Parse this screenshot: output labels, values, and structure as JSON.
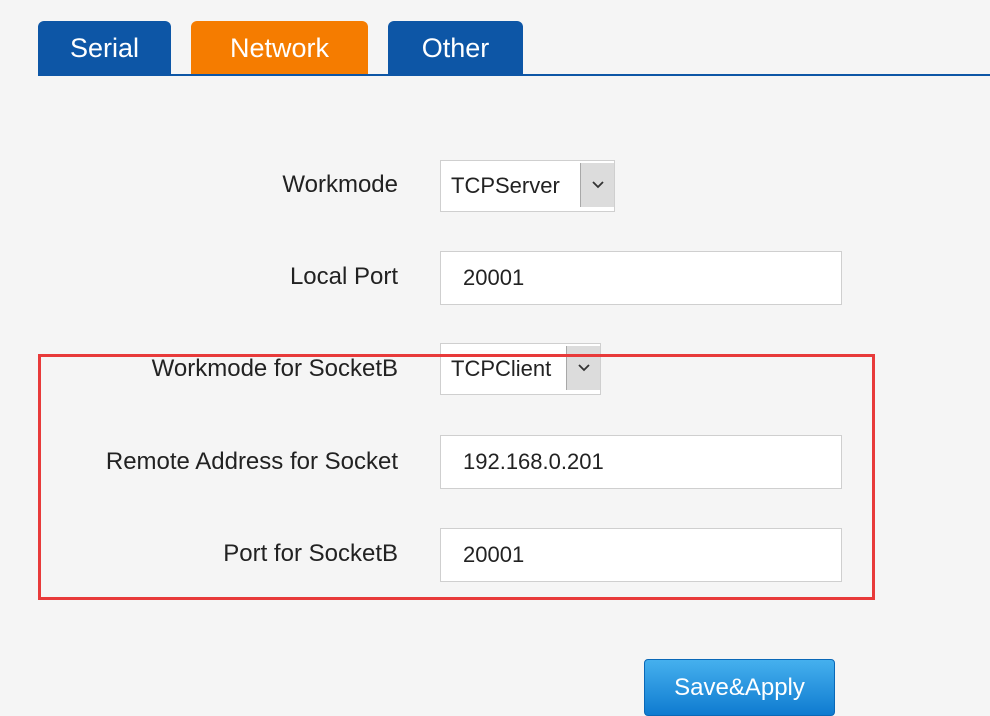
{
  "tabs": [
    {
      "label": "Serial",
      "state": "inactive"
    },
    {
      "label": "Network",
      "state": "active"
    },
    {
      "label": "Other",
      "state": "inactive"
    }
  ],
  "colors": {
    "tab_blue": "#0d56a6",
    "tab_active_orange": "#f57c00",
    "highlight_red": "#e83a3a",
    "button_blue": "#1a8ad8"
  },
  "form": {
    "workmode": {
      "label": "Workmode",
      "value": "TCPServer",
      "arrow_icon": "chevron-down-icon"
    },
    "local_port": {
      "label": "Local Port",
      "value": "20001"
    },
    "workmode_socketb": {
      "label": "Workmode for SocketB",
      "value": "TCPClient",
      "arrow_icon": "chevron-down-icon"
    },
    "remote_address": {
      "label": "Remote Address for Socket",
      "value": "192.168.0.201"
    },
    "port_socketb": {
      "label": "Port for SocketB",
      "value": "20001"
    }
  },
  "buttons": {
    "save_apply": "Save&Apply"
  }
}
